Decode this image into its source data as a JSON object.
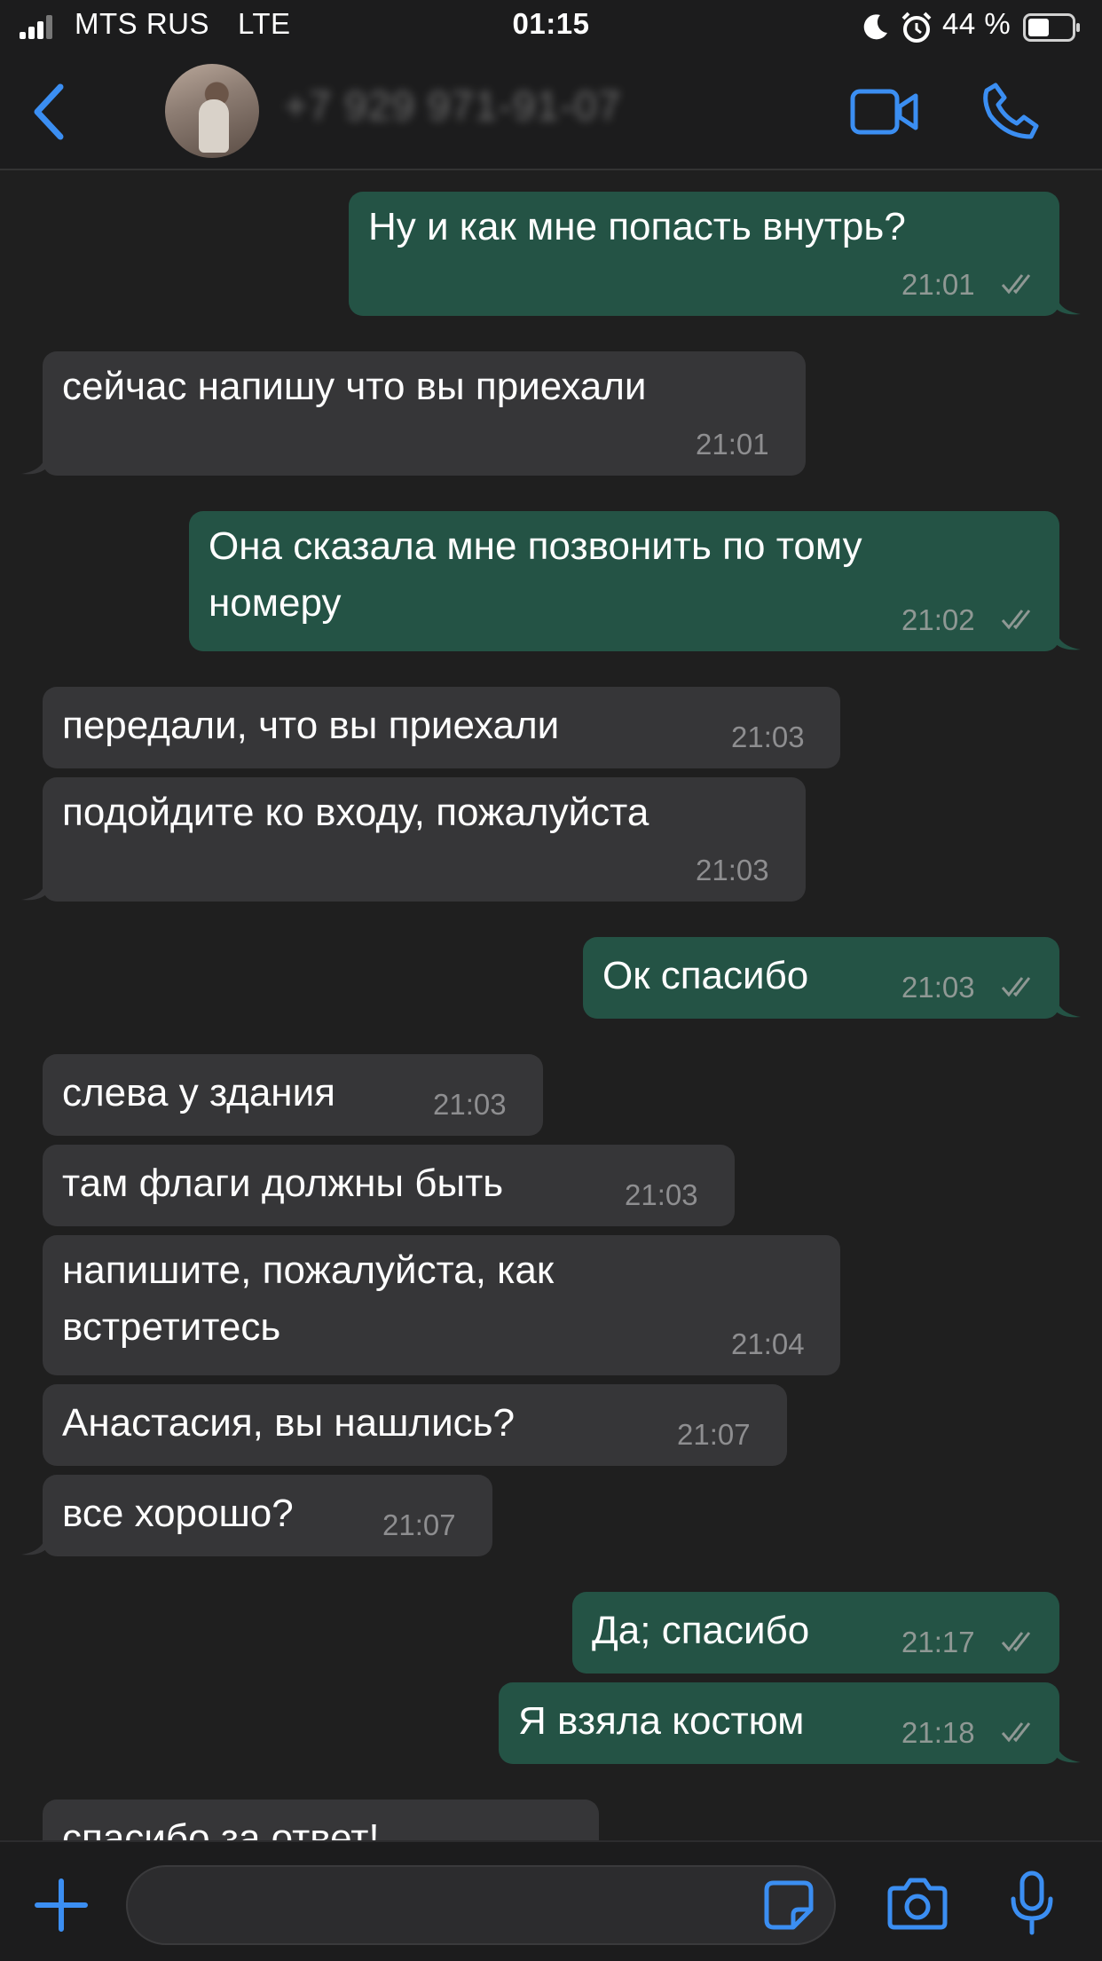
{
  "status_bar": {
    "carrier": "MTS RUS",
    "network": "LTE",
    "time": "01:15",
    "battery_percent": "44 %",
    "icons": [
      "signal-icon",
      "moon-icon",
      "alarm-icon",
      "battery-icon"
    ]
  },
  "header": {
    "contact_name": "+7 929 971-91-07",
    "icons": [
      "back-icon",
      "avatar",
      "video-call-icon",
      "phone-icon"
    ]
  },
  "colors": {
    "outgoing_bubble": "#245345",
    "incoming_bubble": "#363638",
    "accent": "#3b8ef2",
    "background": "#1f1f1f"
  },
  "messages": [
    {
      "dir": "out",
      "text": "Ну и как мне попасть внутрь?",
      "time": "21:01",
      "read": true
    },
    {
      "dir": "in",
      "text": "сейчас напишу что вы приехали",
      "time": "21:01"
    },
    {
      "dir": "out",
      "lines": [
        "Она сказала мне позвонить по тому",
        "номеру"
      ],
      "time": "21:02",
      "read": true
    },
    {
      "dir": "in",
      "text": "передали, что вы приехали",
      "time": "21:03"
    },
    {
      "dir": "in",
      "text": "подойдите ко входу, пожалуйста",
      "time": "21:03"
    },
    {
      "dir": "out",
      "text": "Ок спасибо",
      "time": "21:03",
      "read": true
    },
    {
      "dir": "in",
      "text": "слева у здания",
      "time": "21:03"
    },
    {
      "dir": "in",
      "text": "там флаги должны быть",
      "time": "21:03"
    },
    {
      "dir": "in",
      "lines": [
        "напишите, пожалуйста, как",
        "встретитесь"
      ],
      "time": "21:04"
    },
    {
      "dir": "in",
      "text": "Анастасия, вы нашлись?",
      "time": "21:07"
    },
    {
      "dir": "in",
      "text": "все хорошо?",
      "time": "21:07"
    },
    {
      "dir": "out",
      "text": "Да; спасибо",
      "time": "21:17",
      "read": true
    },
    {
      "dir": "out",
      "text": "Я взяла костюм",
      "time": "21:18",
      "read": true
    },
    {
      "dir": "in",
      "text": "спасибо за ответ!",
      "partial": true
    }
  ],
  "composer": {
    "input_value": "",
    "icons": [
      "plus-icon",
      "sticker-icon",
      "camera-icon",
      "microphone-icon"
    ]
  }
}
